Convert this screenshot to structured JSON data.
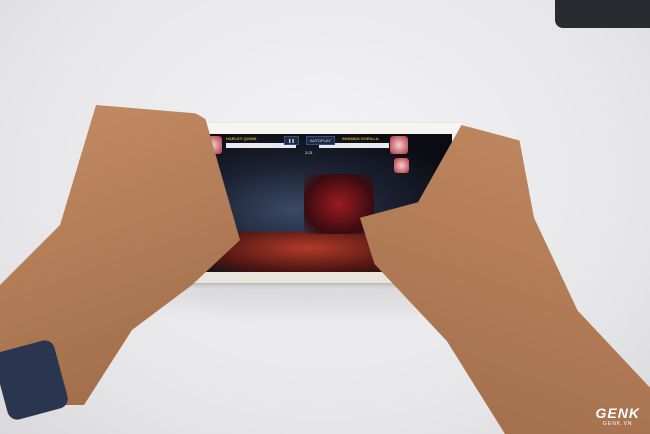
{
  "game_hud": {
    "player_name": "HARLEY QUINN",
    "opponent_name": "SHAMAN GORILLA",
    "autoplay_label": "AUTOPLAY",
    "timer": "2:21"
  },
  "watermark": {
    "logo": "GENK",
    "site": "GENK.VN"
  }
}
